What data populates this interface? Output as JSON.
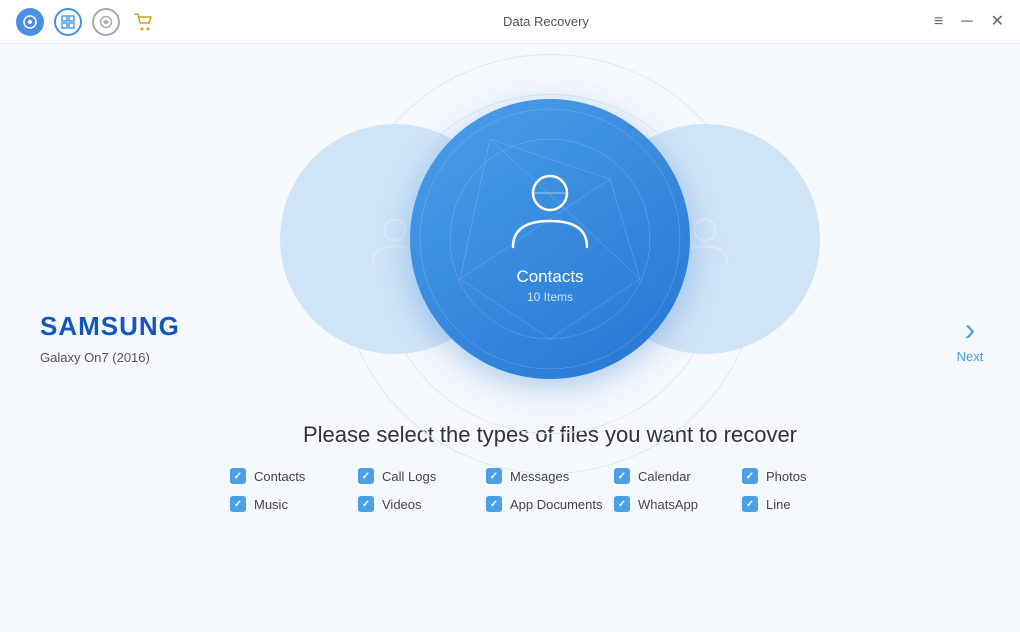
{
  "titlebar": {
    "title": "Data Recovery",
    "icons": {
      "app1": "P",
      "app2": "D",
      "app3": "S",
      "cart": "🛒"
    },
    "window_controls": {
      "menu": "≡",
      "minimize": "─",
      "close": "✕"
    }
  },
  "device": {
    "brand": "SAMSUNG",
    "model": "Galaxy On7 (2016)"
  },
  "carousel": {
    "main_label": "Contacts",
    "main_sublabel": "10 Items"
  },
  "instruction": "Please select the types of files you want to recover",
  "file_types": [
    {
      "id": "contacts",
      "label": "Contacts",
      "checked": true
    },
    {
      "id": "call-logs",
      "label": "Call Logs",
      "checked": true
    },
    {
      "id": "messages",
      "label": "Messages",
      "checked": true
    },
    {
      "id": "calendar",
      "label": "Calendar",
      "checked": true
    },
    {
      "id": "photos",
      "label": "Photos",
      "checked": true
    },
    {
      "id": "music",
      "label": "Music",
      "checked": true
    },
    {
      "id": "videos",
      "label": "Videos",
      "checked": true
    },
    {
      "id": "app-documents",
      "label": "App Documents",
      "checked": true
    },
    {
      "id": "whatsapp",
      "label": "WhatsApp",
      "checked": true
    },
    {
      "id": "line",
      "label": "Line",
      "checked": true
    }
  ],
  "navigation": {
    "next_label": "Next"
  }
}
